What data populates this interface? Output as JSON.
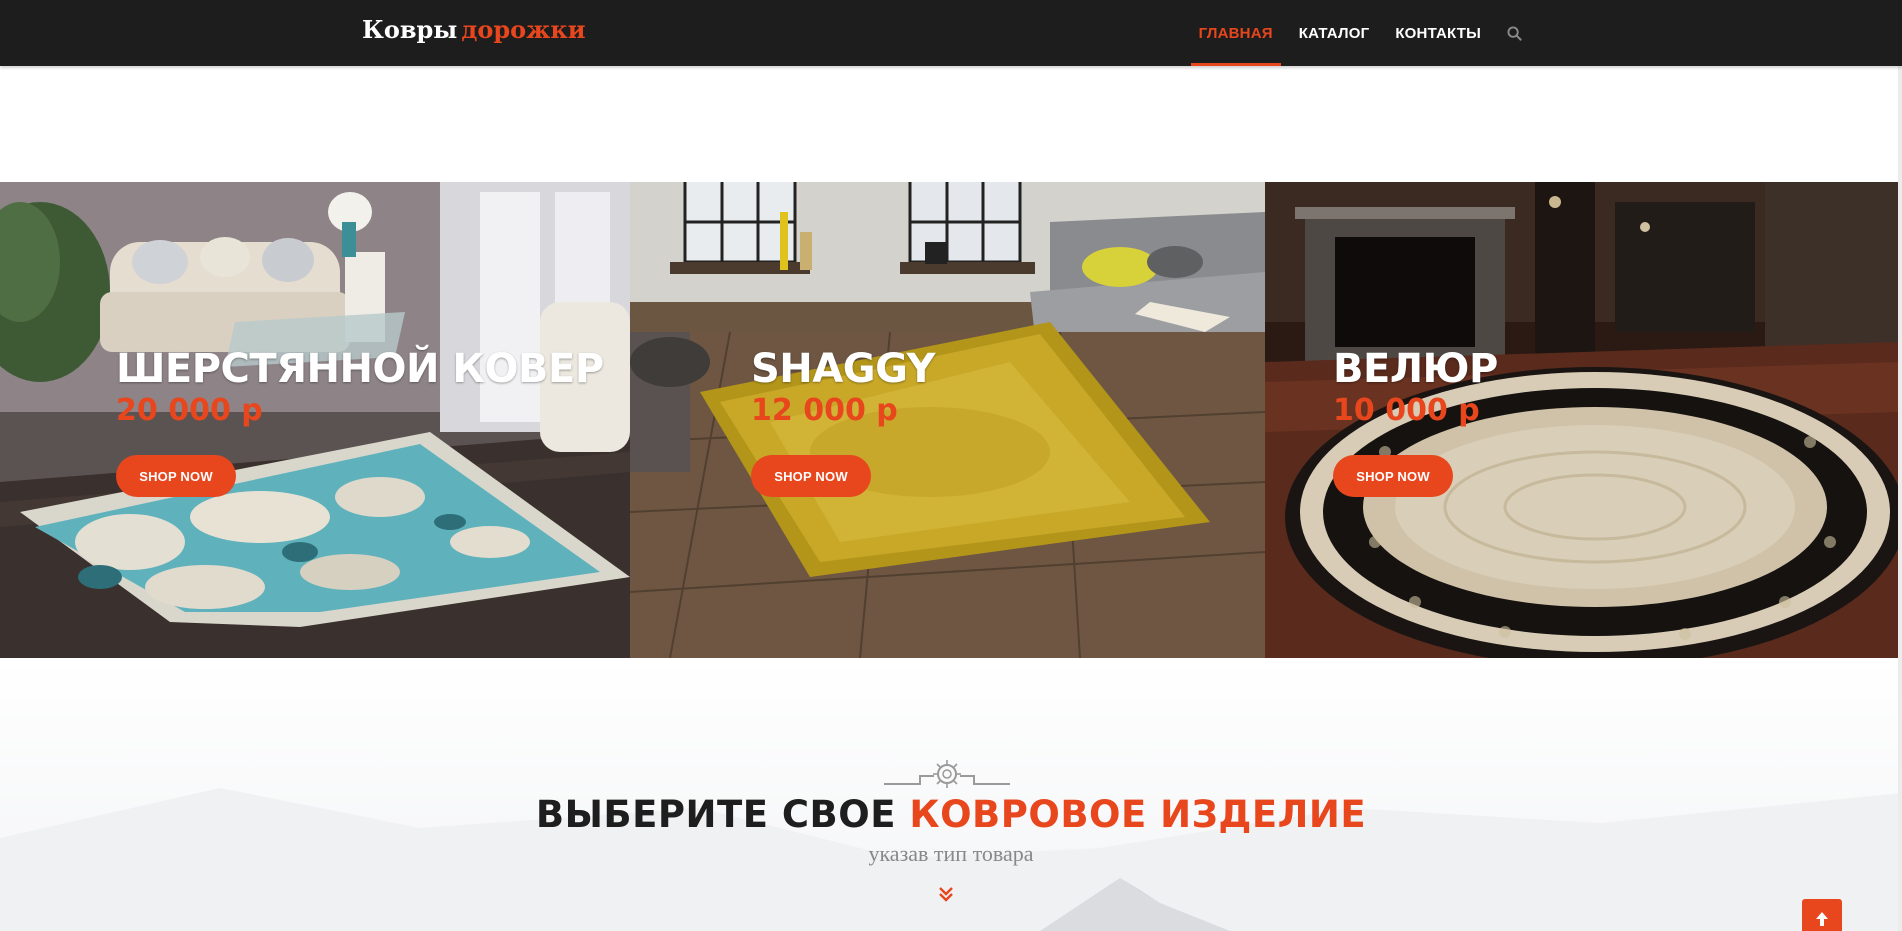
{
  "brand": {
    "name": "Ковры",
    "accent": "дорожки"
  },
  "nav": {
    "items": [
      {
        "label": "ГЛАВНАЯ",
        "active": true
      },
      {
        "label": "КАТАЛОГ",
        "active": false
      },
      {
        "label": "КОНТАКТЫ",
        "active": false
      }
    ],
    "search_icon": "search-icon"
  },
  "panels": [
    {
      "title": "ШЕРСТЯННОЙ КОВЕР",
      "price": "20 000 р",
      "button": "SHOP NOW"
    },
    {
      "title": "SHAGGY",
      "price": "12 000 р",
      "button": "SHOP NOW"
    },
    {
      "title": "ВЕЛЮР",
      "price": "10 000 р",
      "button": "SHOP NOW"
    }
  ],
  "section": {
    "heading_dark": "ВЫБЕРИТЕ СВОЕ",
    "heading_accent": "КОВРОВОЕ ИЗДЕЛИЕ",
    "subheading": "указав тип товара",
    "ornament_icon": "ornament-divider-icon",
    "chevron_icon": "double-chevron-down-icon"
  },
  "back_to_top_icon": "arrow-up-icon",
  "colors": {
    "accent": "#e8461d",
    "navbar": "#1d1d1d",
    "heading": "#1e1e1e",
    "subheading": "#888888"
  }
}
